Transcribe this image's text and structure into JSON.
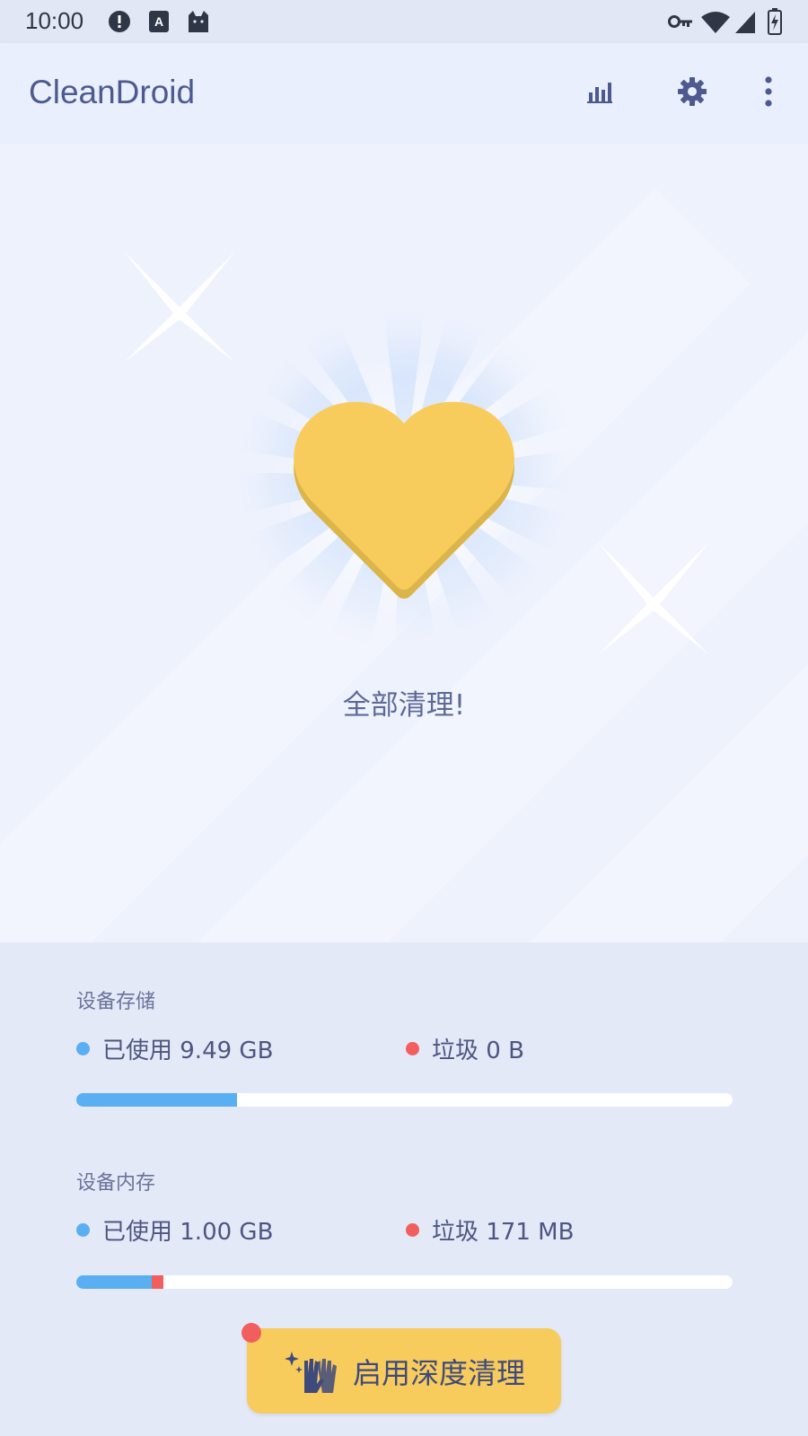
{
  "status_bar": {
    "time": "10:00",
    "icons_left": [
      "alert-circle-icon",
      "a-square-icon",
      "cat-icon"
    ],
    "icons_right": [
      "key-icon",
      "wifi-icon",
      "signal-icon",
      "battery-charging-icon"
    ]
  },
  "app_bar": {
    "title": "CleanDroid",
    "actions": [
      "bar-chart-icon",
      "gear-icon",
      "more-vertical-icon"
    ]
  },
  "hero": {
    "message": "全部清理!",
    "icon": "heart-icon"
  },
  "storage": {
    "title": "设备存储",
    "used_label": "已使用 9.49 GB",
    "junk_label": "垃圾 0 B",
    "used_fraction": 0.245,
    "junk_fraction": 0.0
  },
  "memory": {
    "title": "设备内存",
    "used_label": "已使用 1.00 GB",
    "junk_label": "垃圾 171 MB",
    "used_fraction": 0.115,
    "junk_fraction": 0.018
  },
  "cta": {
    "label": "启用深度清理",
    "icon": "gloves-sparkle-icon"
  },
  "colors": {
    "accent": "#4c5a8f",
    "used": "#5aaef2",
    "junk": "#f25e5e",
    "button": "#f7cb5c"
  }
}
